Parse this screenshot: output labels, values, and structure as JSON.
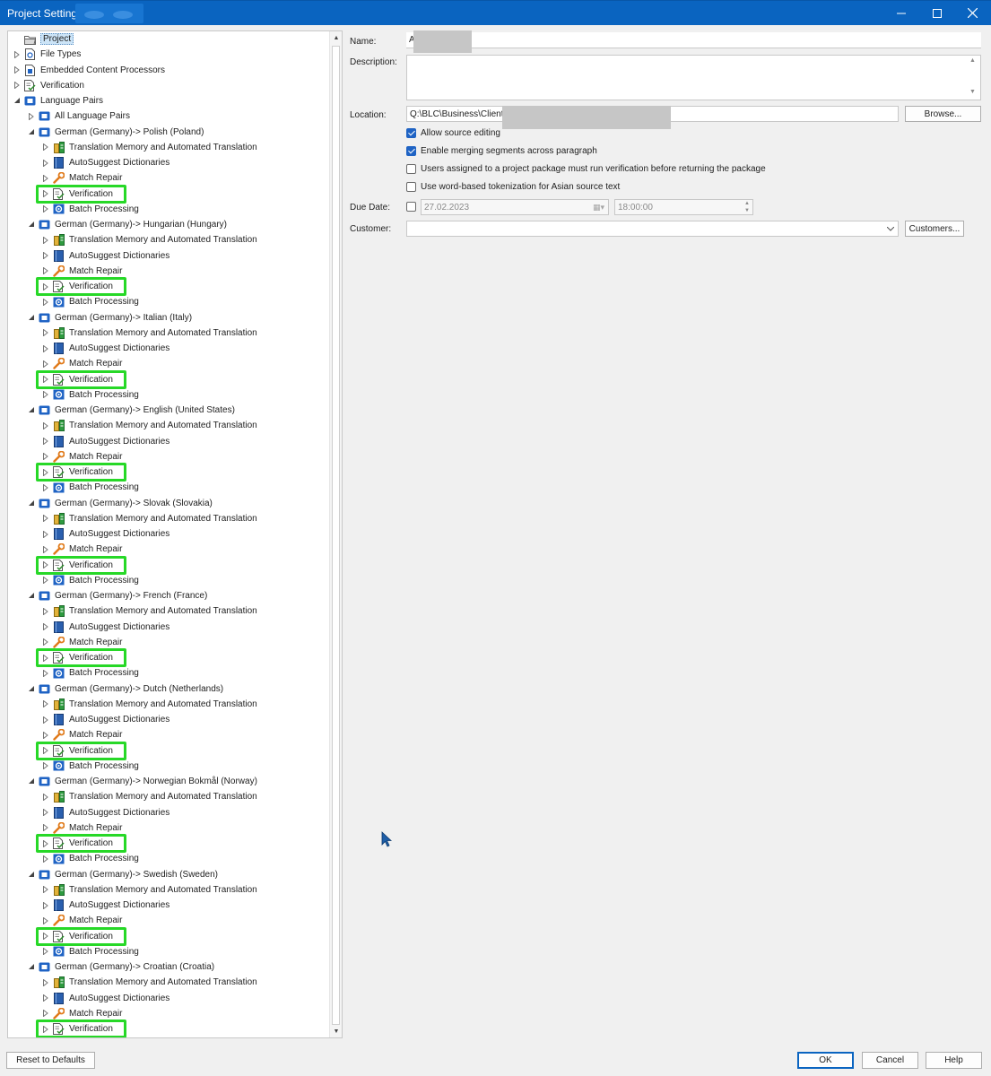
{
  "window": {
    "title": "Project Settings -",
    "controls": [
      "minimize",
      "maximize",
      "close"
    ]
  },
  "tree": {
    "root_items": [
      {
        "label": "Project",
        "icon": "project-folder-icon",
        "selected": true
      },
      {
        "label": "File Types",
        "icon": "file-types-icon"
      },
      {
        "label": "Embedded Content Processors",
        "icon": "embedded-content-icon"
      },
      {
        "label": "Verification",
        "icon": "verification-icon"
      },
      {
        "label": "Language Pairs",
        "icon": "language-pairs-icon"
      }
    ],
    "all_language_pairs": "All Language Pairs",
    "language_pairs": [
      {
        "label": "German (Germany)-> Polish (Poland)"
      },
      {
        "label": "German (Germany)-> Hungarian (Hungary)"
      },
      {
        "label": "German (Germany)-> Italian (Italy)"
      },
      {
        "label": "German (Germany)-> English (United States)"
      },
      {
        "label": "German (Germany)-> Slovak (Slovakia)"
      },
      {
        "label": "German (Germany)-> French (France)"
      },
      {
        "label": "German (Germany)-> Dutch (Netherlands)"
      },
      {
        "label": "German (Germany)-> Norwegian Bokmål (Norway)"
      },
      {
        "label": "German (Germany)-> Swedish (Sweden)"
      },
      {
        "label": "German (Germany)-> Croatian (Croatia)"
      }
    ],
    "child_items": [
      {
        "label": "Translation Memory and Automated Translation",
        "icon": "tm-icon"
      },
      {
        "label": "AutoSuggest Dictionaries",
        "icon": "dictionary-icon"
      },
      {
        "label": "Match Repair",
        "icon": "wrench-icon"
      },
      {
        "label": "Verification",
        "icon": "verification-icon",
        "highlighted": true
      },
      {
        "label": "Batch Processing",
        "icon": "batch-icon"
      }
    ],
    "highlight_color": "#27d827"
  },
  "form": {
    "name_label": "Name:",
    "name_value": "A",
    "description_label": "Description:",
    "description_value": "",
    "location_label": "Location:",
    "location_value": "Q:\\BLC\\Business\\Clients",
    "browse_label": "Browse...",
    "checkboxes": [
      {
        "label": "Allow source editing",
        "checked": true
      },
      {
        "label": "Enable merging segments across paragraph",
        "checked": true
      },
      {
        "label": "Users assigned to a project package must run verification before returning the package",
        "checked": false
      },
      {
        "label": "Use word-based tokenization for Asian source text",
        "checked": false
      }
    ],
    "due_date_label": "Due Date:",
    "due_date_checked": false,
    "due_date_value": "27.02.2023",
    "due_time_value": "18:00:00",
    "customer_label": "Customer:",
    "customer_value": "",
    "customers_button": "Customers..."
  },
  "footer": {
    "reset_label": "Reset to Defaults",
    "ok_label": "OK",
    "cancel_label": "Cancel",
    "help_label": "Help"
  },
  "colors": {
    "titlebar": "#0a64c0",
    "accent": "#1f63c4"
  }
}
